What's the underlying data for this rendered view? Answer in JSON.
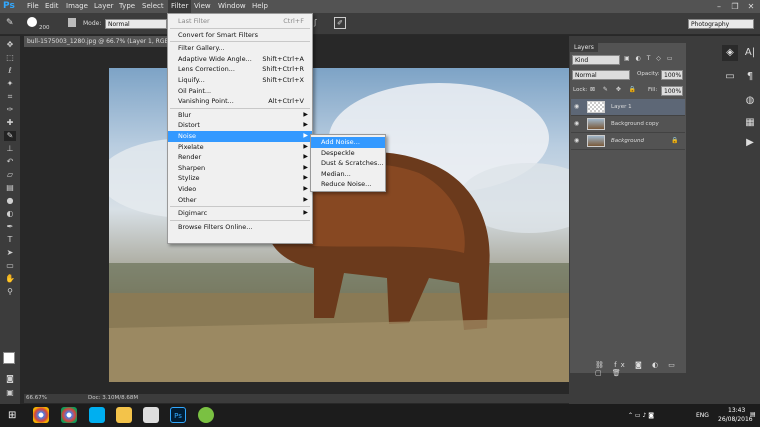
{
  "menubar": {
    "logo": "Ps",
    "items": [
      "File",
      "Edit",
      "Image",
      "Layer",
      "Type",
      "Select",
      "Filter",
      "View",
      "Window",
      "Help"
    ],
    "window_controls": [
      "–",
      "❐",
      "✕"
    ]
  },
  "options": {
    "brush_size": "200",
    "mode_label": "Mode:",
    "mode_value": "Normal",
    "workspace": "Photography"
  },
  "document": {
    "tab_title": "bull-1575003_1280.jpg @ 66.7% (Layer 1, RGB/8",
    "zoom": "66.67%",
    "doc_info": "Doc: 3.10M/8.68M"
  },
  "filter_menu": {
    "items": [
      {
        "label": "Last Filter",
        "shortcut": "Ctrl+F",
        "disabled": true
      },
      {
        "sep": true
      },
      {
        "label": "Convert for Smart Filters"
      },
      {
        "sep": true
      },
      {
        "label": "Filter Gallery..."
      },
      {
        "label": "Adaptive Wide Angle...",
        "shortcut": "Shift+Ctrl+A"
      },
      {
        "label": "Lens Correction...",
        "shortcut": "Shift+Ctrl+R"
      },
      {
        "label": "Liquify...",
        "shortcut": "Shift+Ctrl+X"
      },
      {
        "label": "Oil Paint..."
      },
      {
        "label": "Vanishing Point...",
        "shortcut": "Alt+Ctrl+V"
      },
      {
        "sep": true
      },
      {
        "label": "Blur",
        "submenu": true
      },
      {
        "label": "Distort",
        "submenu": true
      },
      {
        "label": "Noise",
        "submenu": true,
        "highlight": true
      },
      {
        "label": "Pixelate",
        "submenu": true
      },
      {
        "label": "Render",
        "submenu": true
      },
      {
        "label": "Sharpen",
        "submenu": true
      },
      {
        "label": "Stylize",
        "submenu": true
      },
      {
        "label": "Video",
        "submenu": true
      },
      {
        "label": "Other",
        "submenu": true
      },
      {
        "sep": true
      },
      {
        "label": "Digimarc",
        "submenu": true
      },
      {
        "sep": true
      },
      {
        "label": "Browse Filters Online..."
      }
    ]
  },
  "noise_menu": {
    "items": [
      {
        "label": "Add Noise...",
        "highlight": true
      },
      {
        "label": "Despeckle"
      },
      {
        "label": "Dust & Scratches..."
      },
      {
        "label": "Median..."
      },
      {
        "label": "Reduce Noise..."
      }
    ]
  },
  "layers": {
    "tab": "Layers",
    "kind": "Kind",
    "blend": "Normal",
    "opacity_label": "Opacity:",
    "opacity": "100%",
    "lock_label": "Lock:",
    "fill_label": "Fill:",
    "fill": "100%",
    "items": [
      {
        "name": "Layer 1",
        "selected": true
      },
      {
        "name": "Background copy"
      },
      {
        "name": "Background",
        "italic": true,
        "locked": true
      }
    ]
  },
  "taskbar": {
    "lang": "ENG",
    "time": "13:43",
    "date": "26/08/2016"
  }
}
